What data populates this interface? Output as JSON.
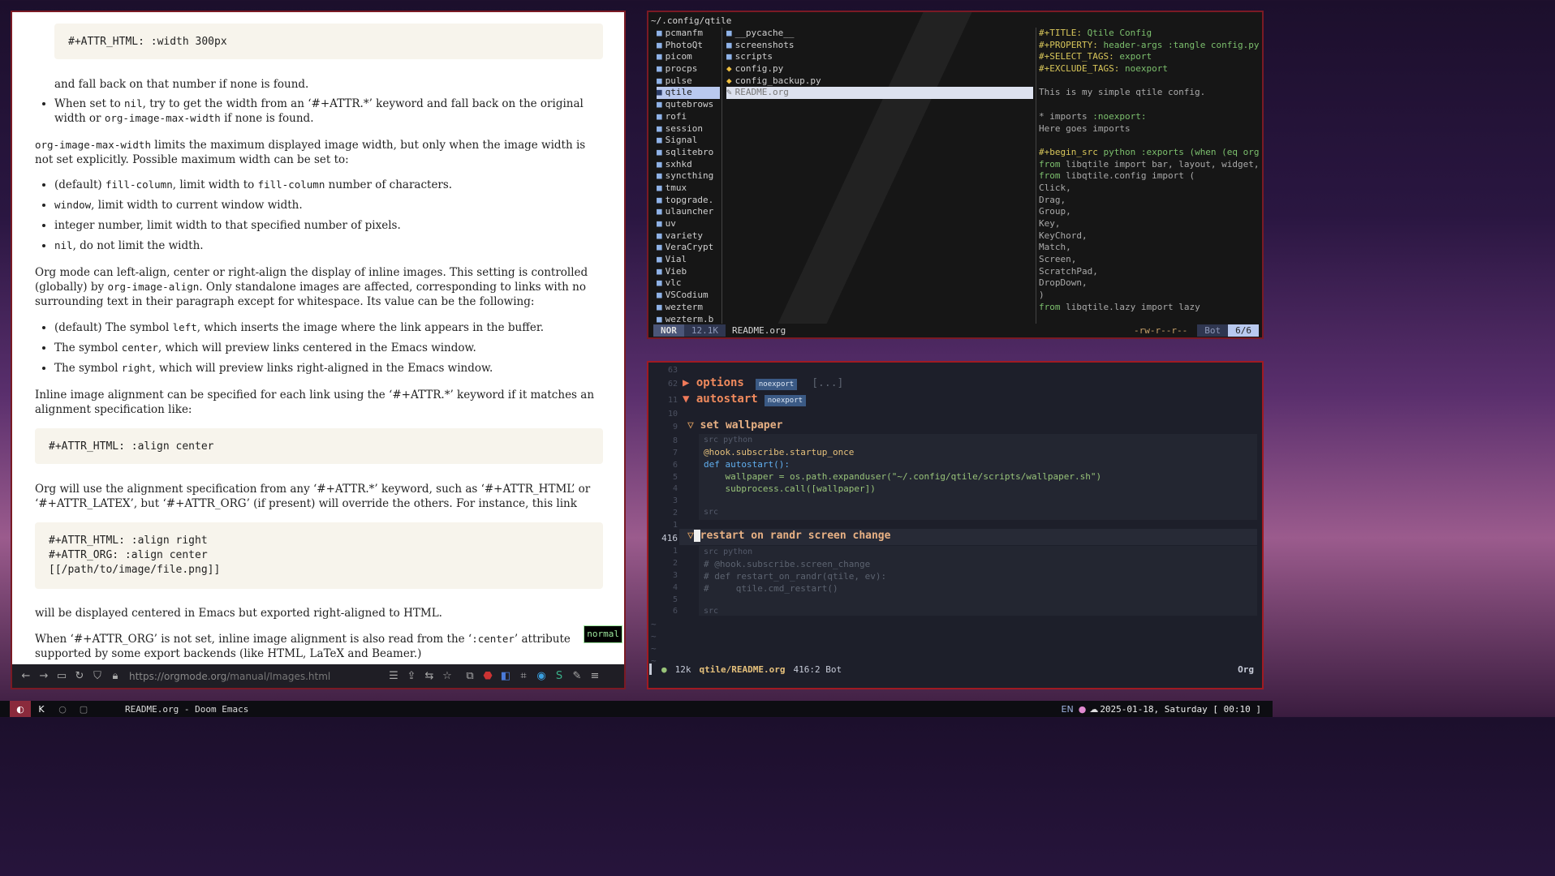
{
  "browser": {
    "code1": "#+ATTR_HTML: :width 300px",
    "p1": "and fall back on that number if none is found.",
    "li_a1": "When set to ",
    "li_a_code": "nil",
    "li_a2": ", try to get the width from an ‘#+ATTR.*’ keyword and fall back on the original width or ",
    "li_a_code2": "org-image-max-width",
    "li_a3": " if none is found.",
    "p2_code": "org-image-max-width",
    "p2": " limits the maximum displayed image width, but only when the image width is not set explicitly. Possible maximum width can be set to:",
    "opt1_pre": "(default) ",
    "opt1_code": "fill-column",
    "opt1_mid": ", limit width to ",
    "opt1_code2": "fill-column",
    "opt1_post": " number of characters.",
    "opt2_code": "window",
    "opt2_post": ", limit width to current window width.",
    "opt3": "integer number, limit width to that specified number of pixels.",
    "opt4_code": "nil",
    "opt4_post": ", do not limit the width.",
    "p3a": "Org mode can left-align, center or right-align the display of inline images. This setting is controlled (globally) by ",
    "p3_code": "org-image-align",
    "p3b": ". Only standalone images are affected, corresponding to links with no surrounding text in their paragraph except for whitespace. Its value can be the following:",
    "al1_pre": "(default) The symbol ",
    "al1_code": "left",
    "al1_post": ", which inserts the image where the link appears in the buffer.",
    "al2_pre": "The symbol ",
    "al2_code": "center",
    "al2_post": ", which will preview links centered in the Emacs window.",
    "al3_pre": "The symbol ",
    "al3_code": "right",
    "al3_post": ", which will preview links right-aligned in the Emacs window.",
    "p4": "Inline image alignment can be specified for each link using the ‘#+ATTR.*’ keyword if it matches an alignment specification like:",
    "code2": "#+ATTR_HTML: :align center",
    "p5": "Org will use the alignment specification from any ‘#+ATTR.*’ keyword, such as ‘#+ATTR_HTML’ or ‘#+ATTR_LATEX’, but ‘#+ATTR_ORG’ (if present) will override the others. For instance, this link",
    "code3": [
      "#+ATTR_HTML: :align right",
      "#+ATTR_ORG: :align center",
      "[[/path/to/image/file.png]]"
    ],
    "p6": "will be displayed centered in Emacs but exported right-aligned to HTML.",
    "p7a": "When ‘#+ATTR_ORG’ is not set, inline image alignment is also read from the ‘",
    "p7_code": ":center",
    "p7b": "’ attribute supported by some export backends (like HTML, LaTeX and Beamer.)",
    "vim_mode": "normal",
    "url_host": "https://orgmode.org",
    "url_path": "/manual/Images.html"
  },
  "ranger": {
    "path": "~/.config/qtile",
    "parent_dirs": [
      "pcmanfm",
      "PhotoQt",
      "picom",
      "procps",
      "pulse",
      "qtile",
      "qutebrows",
      "rofi",
      "session",
      "Signal",
      "sqlitebro",
      "sxhkd",
      "syncthing",
      "tmux",
      "topgrade.",
      "ulauncher",
      "uv",
      "variety",
      "VeraCrypt",
      "Vial",
      "Vieb",
      "vlc",
      "VSCodium",
      "wezterm",
      "wezterm.b"
    ],
    "selected_parent": 5,
    "current_files": [
      {
        "name": "__pycache__",
        "icon": "folder"
      },
      {
        "name": "screenshots",
        "icon": "folder"
      },
      {
        "name": "scripts",
        "icon": "folder"
      },
      {
        "name": "config.py",
        "icon": "python"
      },
      {
        "name": "config_backup.py",
        "icon": "python"
      },
      {
        "name": "README.org",
        "icon": "org"
      }
    ],
    "preview": [
      [
        "kw",
        "#+TITLE:",
        "gr",
        " Qtile Config"
      ],
      [
        "kw",
        "#+PROPERTY:",
        "gr",
        " header-args :tangle config.py"
      ],
      [
        "kw",
        "#+SELECT_TAGS:",
        "gr",
        " export"
      ],
      [
        "kw",
        "#+EXCLUDE_TAGS:",
        "gr",
        " noexport"
      ],
      [
        "op",
        "",
        "op",
        ""
      ],
      [
        "op",
        "This is my simple qtile config.",
        "op",
        ""
      ],
      [
        "op",
        "",
        "op",
        ""
      ],
      [
        "op",
        "* imports",
        "gr",
        " :noexport:"
      ],
      [
        "op",
        "Here goes imports",
        "op",
        ""
      ],
      [
        "op",
        "",
        "op",
        ""
      ],
      [
        "kw",
        "#+begin_src",
        "gr",
        " python :exports (when (eq org"
      ],
      [
        "gr",
        "from",
        "op",
        " libqtile import bar, layout, widget,"
      ],
      [
        "gr",
        "from",
        "op",
        " libqtile.config import ("
      ],
      [
        "op",
        "    Click,",
        "op",
        ""
      ],
      [
        "op",
        "    Drag,",
        "op",
        ""
      ],
      [
        "op",
        "    Group,",
        "op",
        ""
      ],
      [
        "op",
        "    Key,",
        "op",
        ""
      ],
      [
        "op",
        "    KeyChord,",
        "op",
        ""
      ],
      [
        "op",
        "    Match,",
        "op",
        ""
      ],
      [
        "op",
        "    Screen,",
        "op",
        ""
      ],
      [
        "op",
        "    ScratchPad,",
        "op",
        ""
      ],
      [
        "op",
        "    DropDown,",
        "op",
        ""
      ],
      [
        "op",
        ")",
        "op",
        ""
      ],
      [
        "gr",
        "from",
        "op",
        " libqtile.lazy import lazy"
      ]
    ],
    "status_mode": "NOR",
    "status_size": "12.1K",
    "status_file": "README.org",
    "status_perms": "-rw-r--r--",
    "status_pos": "Bot",
    "status_count": "6/6"
  },
  "emacs": {
    "h_options": "options",
    "h_autostart": "autostart",
    "tag_noexport": "noexport",
    "ellipsis": "[...]",
    "h_wallpaper": "set wallpaper",
    "src_label": "src python",
    "src_end": "src",
    "code_wall": [
      "@hook.subscribe.startup_once",
      "def autostart():",
      "    wallpaper = os.path.expanduser(\"~/.config/qtile/scripts/wallpaper.sh\")",
      "    subprocess.call([wallpaper])"
    ],
    "h_restart": "restart on randr screen change",
    "code_restart": [
      "# @hook.subscribe.screen_change",
      "# def restart_on_randr(qtile, ev):",
      "#     qtile.cmd_restart()"
    ],
    "line_numbers": [
      "63",
      "62",
      "11",
      "10",
      "9",
      "8",
      "7",
      "6",
      "5",
      "4",
      "3",
      "2",
      "1",
      "416",
      "1",
      "2",
      "3",
      "4",
      "5",
      "6"
    ],
    "mode_size": "12k",
    "mode_file": "qtile/README.org",
    "mode_pos": "416:2 Bot",
    "mode_major": "Org"
  },
  "panel": {
    "window_title": "README.org - Doom Emacs",
    "lang": "EN",
    "clock": "2025-01-18, Saturday [ 00:10 ]"
  }
}
